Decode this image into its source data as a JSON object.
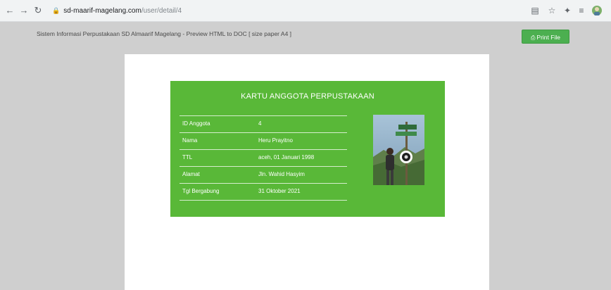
{
  "browser": {
    "back_icon": "arrow-left-icon",
    "forward_icon": "arrow-right-icon",
    "reload_icon": "reload-icon",
    "url_host": "sd-maarif-magelang.com",
    "url_path": "/user/detail/4"
  },
  "page": {
    "heading": "Sistem Informasi Perpustakaan SD Almaarif Magelang - Preview HTML to DOC [ size paper A4 ]",
    "print_label": "Print File"
  },
  "card": {
    "title": "KARTU ANGGOTA PERPUSTAKAAN",
    "rows": [
      {
        "label": "ID Anggota",
        "value": "4"
      },
      {
        "label": "Nama",
        "value": "Heru Prayitno"
      },
      {
        "label": "TTL",
        "value": "aceh, 01 Januari 1998"
      },
      {
        "label": "Alamat",
        "value": "Jln. Wahid Hasyim"
      },
      {
        "label": "Tgl Bergabung",
        "value": "31 Oktober 2021"
      }
    ]
  },
  "colors": {
    "card_green": "#59b838",
    "button_green": "#4caf50"
  }
}
